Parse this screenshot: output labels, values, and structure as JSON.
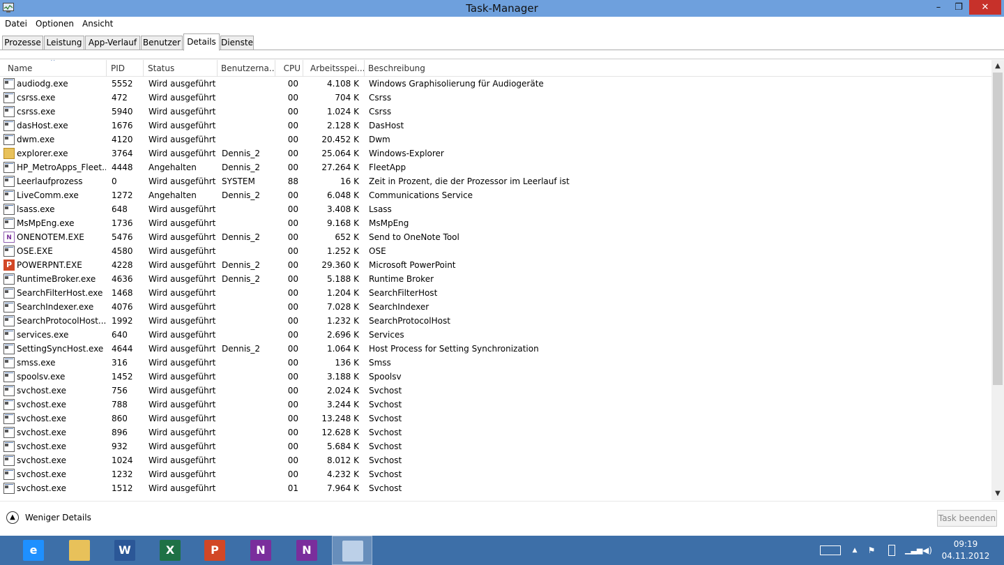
{
  "window": {
    "title": "Task-Manager",
    "minimize": "–",
    "maximize": "❐",
    "close": "✕"
  },
  "menu": [
    "Datei",
    "Optionen",
    "Ansicht"
  ],
  "tabs": [
    "Prozesse",
    "Leistung",
    "App-Verlauf",
    "Benutzer",
    "Details",
    "Dienste"
  ],
  "active_tab": "Details",
  "columns": {
    "name": "Name",
    "pid": "PID",
    "status": "Status",
    "user": "Benutzerna...",
    "cpu": "CPU",
    "memory": "Arbeitsspei...",
    "description": "Beschreibung",
    "sort_indicator": "^"
  },
  "processes": [
    {
      "icon": "generic-process-icon",
      "name": "audiodg.exe",
      "pid": "5552",
      "status": "Wird ausgeführt",
      "user": "",
      "cpu": "00",
      "memory": "4.108 K",
      "description": "Windows Graphisolierung für Audiogeräte"
    },
    {
      "icon": "generic-process-icon",
      "name": "csrss.exe",
      "pid": "472",
      "status": "Wird ausgeführt",
      "user": "",
      "cpu": "00",
      "memory": "704 K",
      "description": "Csrss"
    },
    {
      "icon": "generic-process-icon",
      "name": "csrss.exe",
      "pid": "5940",
      "status": "Wird ausgeführt",
      "user": "",
      "cpu": "00",
      "memory": "1.024 K",
      "description": "Csrss"
    },
    {
      "icon": "generic-process-icon",
      "name": "dasHost.exe",
      "pid": "1676",
      "status": "Wird ausgeführt",
      "user": "",
      "cpu": "00",
      "memory": "2.128 K",
      "description": "DasHost"
    },
    {
      "icon": "generic-process-icon",
      "name": "dwm.exe",
      "pid": "4120",
      "status": "Wird ausgeführt",
      "user": "",
      "cpu": "00",
      "memory": "20.452 K",
      "description": "Dwm"
    },
    {
      "icon": "explorer-folder-icon",
      "name": "explorer.exe",
      "pid": "3764",
      "status": "Wird ausgeführt",
      "user": "Dennis_2",
      "cpu": "00",
      "memory": "25.064 K",
      "description": "Windows-Explorer"
    },
    {
      "icon": "generic-process-icon",
      "name": "HP_MetroApps_Fleet...",
      "pid": "4448",
      "status": "Angehalten",
      "user": "Dennis_2",
      "cpu": "00",
      "memory": "27.264 K",
      "description": "FleetApp"
    },
    {
      "icon": "generic-process-icon",
      "name": "Leerlaufprozess",
      "pid": "0",
      "status": "Wird ausgeführt",
      "user": "SYSTEM",
      "cpu": "88",
      "memory": "16 K",
      "description": "Zeit in Prozent, die der Prozessor im Leerlauf ist"
    },
    {
      "icon": "generic-process-icon",
      "name": "LiveComm.exe",
      "pid": "1272",
      "status": "Angehalten",
      "user": "Dennis_2",
      "cpu": "00",
      "memory": "6.048 K",
      "description": "Communications Service"
    },
    {
      "icon": "generic-process-icon",
      "name": "lsass.exe",
      "pid": "648",
      "status": "Wird ausgeführt",
      "user": "",
      "cpu": "00",
      "memory": "3.408 K",
      "description": "Lsass"
    },
    {
      "icon": "generic-process-icon",
      "name": "MsMpEng.exe",
      "pid": "1736",
      "status": "Wird ausgeführt",
      "user": "",
      "cpu": "00",
      "memory": "9.168 K",
      "description": "MsMpEng"
    },
    {
      "icon": "onenote-icon",
      "name": "ONENOTEM.EXE",
      "pid": "5476",
      "status": "Wird ausgeführt",
      "user": "Dennis_2",
      "cpu": "00",
      "memory": "652 K",
      "description": "Send to OneNote Tool"
    },
    {
      "icon": "generic-process-icon",
      "name": "OSE.EXE",
      "pid": "4580",
      "status": "Wird ausgeführt",
      "user": "",
      "cpu": "00",
      "memory": "1.252 K",
      "description": "OSE"
    },
    {
      "icon": "powerpoint-icon",
      "name": "POWERPNT.EXE",
      "pid": "4228",
      "status": "Wird ausgeführt",
      "user": "Dennis_2",
      "cpu": "00",
      "memory": "29.360 K",
      "description": "Microsoft PowerPoint"
    },
    {
      "icon": "generic-process-icon",
      "name": "RuntimeBroker.exe",
      "pid": "4636",
      "status": "Wird ausgeführt",
      "user": "Dennis_2",
      "cpu": "00",
      "memory": "5.188 K",
      "description": "Runtime Broker"
    },
    {
      "icon": "generic-process-icon",
      "name": "SearchFilterHost.exe",
      "pid": "1468",
      "status": "Wird ausgeführt",
      "user": "",
      "cpu": "00",
      "memory": "1.204 K",
      "description": "SearchFilterHost"
    },
    {
      "icon": "generic-process-icon",
      "name": "SearchIndexer.exe",
      "pid": "4076",
      "status": "Wird ausgeführt",
      "user": "",
      "cpu": "00",
      "memory": "7.028 K",
      "description": "SearchIndexer"
    },
    {
      "icon": "generic-process-icon",
      "name": "SearchProtocolHost....",
      "pid": "1992",
      "status": "Wird ausgeführt",
      "user": "",
      "cpu": "00",
      "memory": "1.232 K",
      "description": "SearchProtocolHost"
    },
    {
      "icon": "generic-process-icon",
      "name": "services.exe",
      "pid": "640",
      "status": "Wird ausgeführt",
      "user": "",
      "cpu": "00",
      "memory": "2.696 K",
      "description": "Services"
    },
    {
      "icon": "generic-process-icon",
      "name": "SettingSyncHost.exe",
      "pid": "4644",
      "status": "Wird ausgeführt",
      "user": "Dennis_2",
      "cpu": "00",
      "memory": "1.064 K",
      "description": "Host Process for Setting Synchronization"
    },
    {
      "icon": "generic-process-icon",
      "name": "smss.exe",
      "pid": "316",
      "status": "Wird ausgeführt",
      "user": "",
      "cpu": "00",
      "memory": "136 K",
      "description": "Smss"
    },
    {
      "icon": "generic-process-icon",
      "name": "spoolsv.exe",
      "pid": "1452",
      "status": "Wird ausgeführt",
      "user": "",
      "cpu": "00",
      "memory": "3.188 K",
      "description": "Spoolsv"
    },
    {
      "icon": "generic-process-icon",
      "name": "svchost.exe",
      "pid": "756",
      "status": "Wird ausgeführt",
      "user": "",
      "cpu": "00",
      "memory": "2.024 K",
      "description": "Svchost"
    },
    {
      "icon": "generic-process-icon",
      "name": "svchost.exe",
      "pid": "788",
      "status": "Wird ausgeführt",
      "user": "",
      "cpu": "00",
      "memory": "3.244 K",
      "description": "Svchost"
    },
    {
      "icon": "generic-process-icon",
      "name": "svchost.exe",
      "pid": "860",
      "status": "Wird ausgeführt",
      "user": "",
      "cpu": "00",
      "memory": "13.248 K",
      "description": "Svchost"
    },
    {
      "icon": "generic-process-icon",
      "name": "svchost.exe",
      "pid": "896",
      "status": "Wird ausgeführt",
      "user": "",
      "cpu": "00",
      "memory": "12.628 K",
      "description": "Svchost"
    },
    {
      "icon": "generic-process-icon",
      "name": "svchost.exe",
      "pid": "932",
      "status": "Wird ausgeführt",
      "user": "",
      "cpu": "00",
      "memory": "5.684 K",
      "description": "Svchost"
    },
    {
      "icon": "generic-process-icon",
      "name": "svchost.exe",
      "pid": "1024",
      "status": "Wird ausgeführt",
      "user": "",
      "cpu": "00",
      "memory": "8.012 K",
      "description": "Svchost"
    },
    {
      "icon": "generic-process-icon",
      "name": "svchost.exe",
      "pid": "1232",
      "status": "Wird ausgeführt",
      "user": "",
      "cpu": "00",
      "memory": "4.232 K",
      "description": "Svchost"
    },
    {
      "icon": "generic-process-icon",
      "name": "svchost.exe",
      "pid": "1512",
      "status": "Wird ausgeführt",
      "user": "",
      "cpu": "01",
      "memory": "7.964 K",
      "description": "Svchost"
    }
  ],
  "footer": {
    "fewer_details": "Weniger Details",
    "end_task": "Task beenden"
  },
  "taskbar": {
    "apps": [
      {
        "name": "internet-explorer",
        "glyph": "e",
        "color": "#1e90ff"
      },
      {
        "name": "file-explorer",
        "glyph": "",
        "color": "#e8c15a"
      },
      {
        "name": "word",
        "glyph": "W",
        "color": "#2b5797"
      },
      {
        "name": "excel",
        "glyph": "X",
        "color": "#1e7145"
      },
      {
        "name": "powerpoint",
        "glyph": "P",
        "color": "#d24726"
      },
      {
        "name": "onenote",
        "glyph": "N",
        "color": "#7a2e9c"
      },
      {
        "name": "onenote-clipping",
        "glyph": "N",
        "color": "#7a2e9c"
      },
      {
        "name": "task-manager",
        "glyph": "",
        "color": "#bcd0e8"
      }
    ],
    "active_app": "task-manager",
    "tray_icons": [
      "keyboard-icon",
      "show-hidden-icons-icon",
      "action-center-flag-icon",
      "battery-icon",
      "network-signal-icon",
      "volume-icon"
    ],
    "time": "09:19",
    "date": "04.11.2012"
  },
  "colors": {
    "titlebar": "#6ea0dd",
    "close_button": "#c7312a",
    "taskbar": "#3d6fa8"
  }
}
